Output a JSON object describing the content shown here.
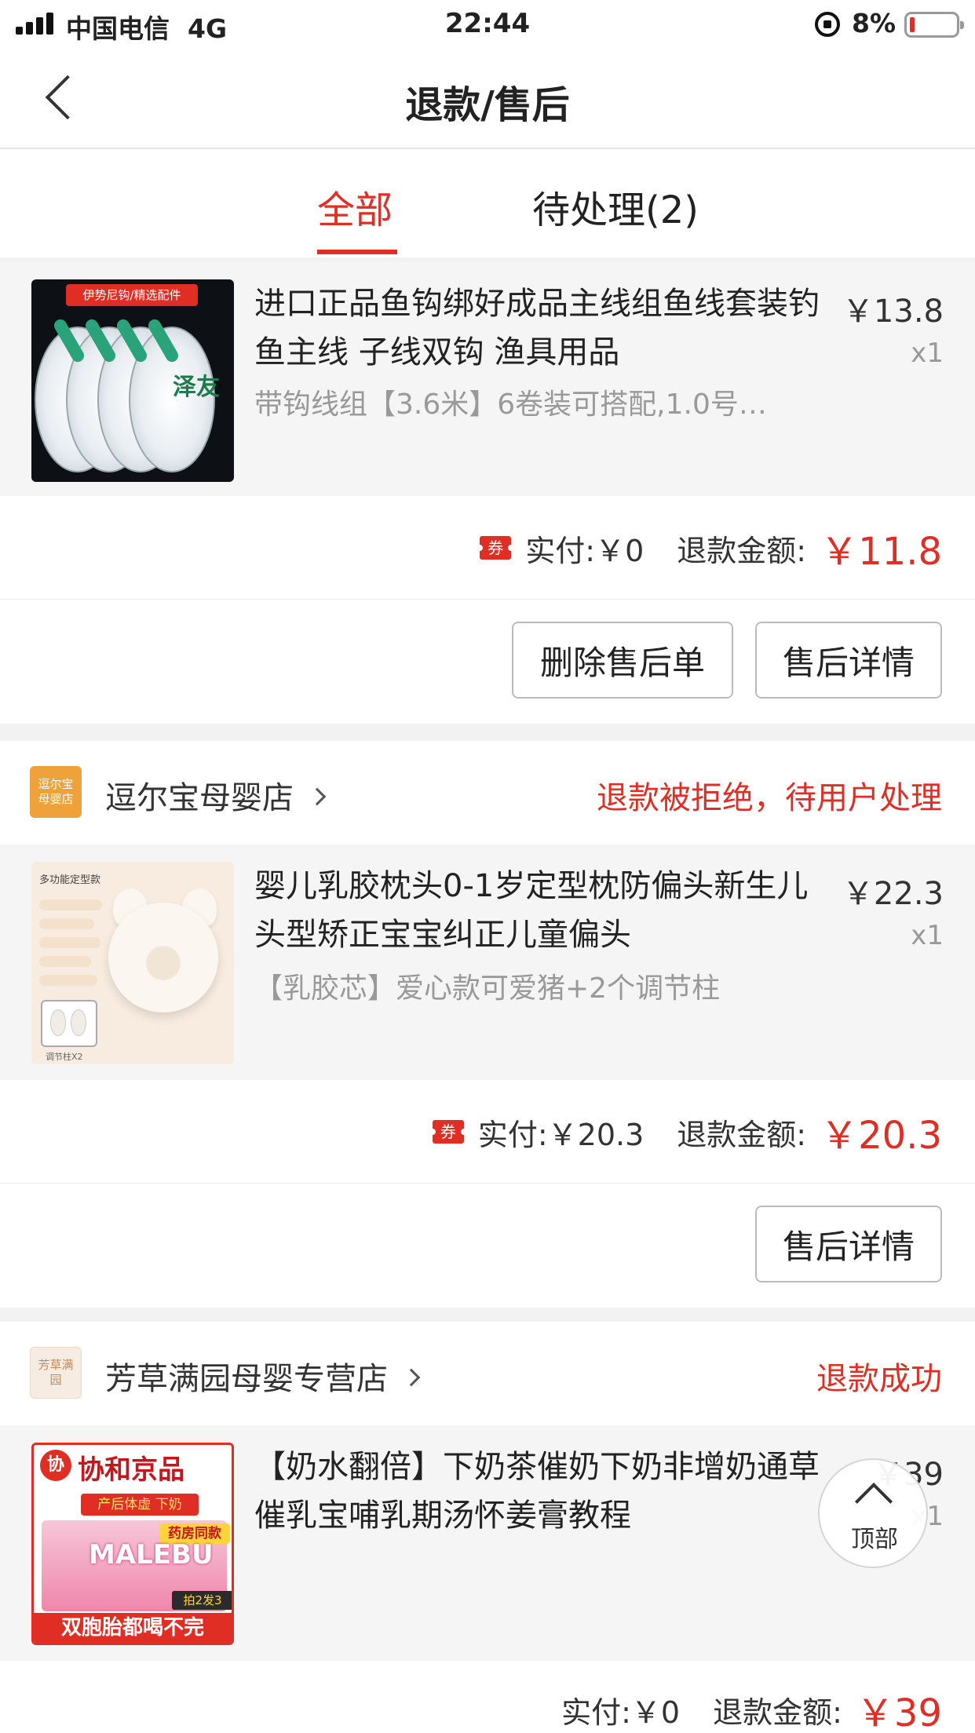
{
  "status_bar": {
    "carrier": "中国电信",
    "network": "4G",
    "time": "22:44",
    "battery": "8%"
  },
  "nav": {
    "title": "退款/售后"
  },
  "tabs": [
    {
      "label": "全部",
      "active": true
    },
    {
      "label": "待处理(2)",
      "active": false
    }
  ],
  "orders": [
    {
      "product": {
        "thumb_text": "伊势尼钩/精选配件",
        "thumb_brand": "泽友",
        "name": "进口正品鱼钩绑好成品主线组鱼线套装钓鱼主线 子线双钩 渔具用品",
        "spec": "带钩线组【3.6米】6卷装可搭配,1.0号…",
        "price": "￥13.8",
        "qty": "x1"
      },
      "coupon": "券",
      "paid_label": "实付:",
      "paid": "￥0",
      "refund_label": "退款金额:",
      "refund": "￥11.8",
      "buttons": [
        "删除售后单",
        "售后详情"
      ]
    },
    {
      "shop": {
        "name": "逗尔宝母婴店",
        "logo_text": "逗尔宝母婴店",
        "status": "退款被拒绝，待用户处理"
      },
      "product": {
        "thumb_text": "多功能定型款",
        "thumb_sub": "调节柱X2",
        "name": "婴儿乳胶枕头0-1岁定型枕防偏头新生儿头型矫正宝宝纠正儿童偏头",
        "spec": "【乳胶芯】爱心款可爱猪+2个调节柱",
        "price": "￥22.3",
        "qty": "x1"
      },
      "coupon": "券",
      "paid_label": "实付:",
      "paid": "￥20.3",
      "refund_label": "退款金额:",
      "refund": "￥20.3",
      "buttons": [
        "售后详情"
      ]
    },
    {
      "shop": {
        "name": "芳草满园母婴专营店",
        "logo_text": "芳草满园",
        "status": "退款成功"
      },
      "product": {
        "thumb_logo": "协",
        "thumb_brand": "协和京品",
        "thumb_sub": "产后体虚 下奶",
        "thumb_name": "MALEBU",
        "thumb_badge": "药房同款",
        "thumb_promo": "拍2发3",
        "thumb_slogan": "双胞胎都喝不完",
        "name": "【奶水翻倍】下奶茶催奶下奶非增奶通草催乳宝哺乳期汤怀姜膏教程",
        "price": "￥39",
        "qty": "x1"
      },
      "paid_label": "实付:",
      "paid": "￥0",
      "refund_label": "退款金额:",
      "refund": "￥39"
    }
  ],
  "to_top": {
    "label": "顶部"
  },
  "colors": {
    "accent": "#e02e24",
    "background": "#f2f2f2"
  }
}
